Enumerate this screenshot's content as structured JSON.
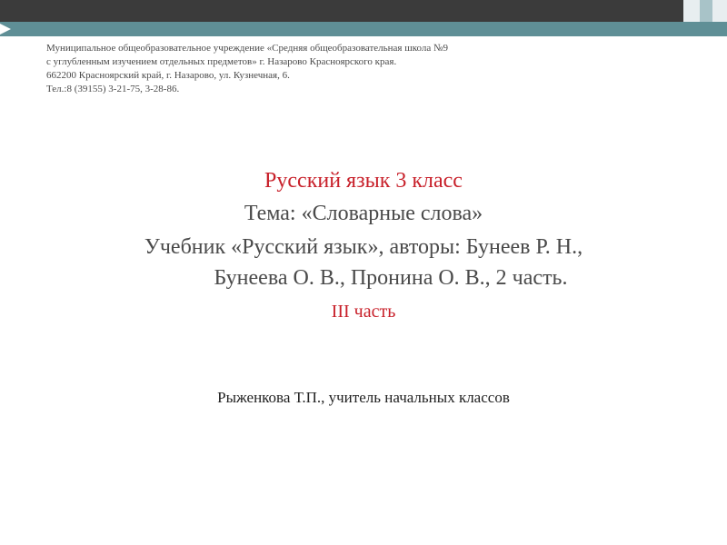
{
  "header": {
    "lines": [
      "Муниципальное общеобразовательное учреждение «Средняя общеобразовательная школа №9",
      "с углубленным изучением отдельных предметов» г. Назарово Красноярского края.",
      "662200 Красноярский край,  г. Назарово, ул. Кузнечная, 6.",
      "Тел.:8 (39155) 3-21-75, 3-28-86."
    ]
  },
  "title": {
    "subject": "Русский язык 3 класс",
    "topic": "Тема: «Словарные слова»",
    "textbook_line1": "Учебник «Русский язык», авторы: Бунеев Р. Н.,",
    "textbook_line2": "Бунеева О. В., Пронина О. В., 2 часть.",
    "part": "III часть"
  },
  "author": "Рыженкова Т.П., учитель начальных классов",
  "colors": {
    "accent": "#c8202a",
    "bar_dark": "#3b3b3b",
    "bar_teal": "#5f8f96",
    "text": "#4a4a4a"
  }
}
